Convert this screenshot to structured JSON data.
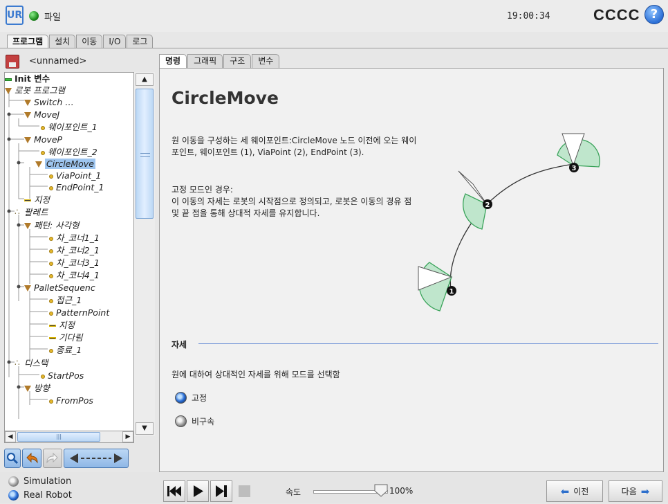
{
  "topbar": {
    "logo": "UR",
    "file_label": "파일",
    "clock": "19:00:34",
    "robot_name": "CCCC",
    "help": "?"
  },
  "main_tabs": [
    "프로그램",
    "설치",
    "이동",
    "I/O",
    "로그"
  ],
  "program": {
    "name": "<unnamed>",
    "tree": [
      {
        "label": "Init 변수",
        "icon": "green-bar",
        "bold": true,
        "italic": false
      },
      {
        "label": "로봇 프로그램",
        "icon": "triangle",
        "bold": false,
        "italic": true
      },
      {
        "label": "Switch …",
        "icon": "triangle",
        "bold": false,
        "italic": true
      },
      {
        "label": "MoveJ",
        "icon": "triangle",
        "bold": false,
        "italic": true
      },
      {
        "label": "웨이포인트_1",
        "icon": "dot",
        "bold": false,
        "italic": true
      },
      {
        "label": "MoveP",
        "icon": "triangle",
        "bold": false,
        "italic": true
      },
      {
        "label": "웨이포인트_2",
        "icon": "dot",
        "bold": false,
        "italic": true
      },
      {
        "label": "CircleMove",
        "icon": "triangle",
        "bold": false,
        "italic": true,
        "selected": true
      },
      {
        "label": "ViaPoint_1",
        "icon": "dot",
        "bold": false,
        "italic": true
      },
      {
        "label": "EndPoint_1",
        "icon": "dot",
        "bold": false,
        "italic": true
      },
      {
        "label": "지정",
        "icon": "bar",
        "bold": false,
        "italic": true
      },
      {
        "label": "팔레트",
        "icon": "pallet",
        "bold": false,
        "italic": true
      },
      {
        "label": "패턴: 사각형",
        "icon": "triangle",
        "bold": false,
        "italic": true
      },
      {
        "label": "차_코너1_1",
        "icon": "dot",
        "bold": false,
        "italic": true
      },
      {
        "label": "차_코너2_1",
        "icon": "dot",
        "bold": false,
        "italic": true
      },
      {
        "label": "차_코너3_1",
        "icon": "dot",
        "bold": false,
        "italic": true
      },
      {
        "label": "차_코너4_1",
        "icon": "dot",
        "bold": false,
        "italic": true
      },
      {
        "label": "PalletSequenc",
        "icon": "triangle",
        "bold": false,
        "italic": true
      },
      {
        "label": "접근_1",
        "icon": "dot",
        "bold": false,
        "italic": true
      },
      {
        "label": "PatternPoint",
        "icon": "dot",
        "bold": false,
        "italic": true
      },
      {
        "label": "지정",
        "icon": "bar",
        "bold": false,
        "italic": true
      },
      {
        "label": "기다림",
        "icon": "bar",
        "bold": false,
        "italic": true
      },
      {
        "label": "종료_1",
        "icon": "dot",
        "bold": false,
        "italic": true
      },
      {
        "label": "디스택",
        "icon": "pallet",
        "bold": false,
        "italic": true
      },
      {
        "label": "StartPos",
        "icon": "dot",
        "bold": false,
        "italic": true
      },
      {
        "label": "방향",
        "icon": "triangle",
        "bold": false,
        "italic": true
      },
      {
        "label": "FromPos",
        "icon": "dot",
        "bold": false,
        "italic": true
      }
    ]
  },
  "sub_tabs": [
    "명령",
    "그래픽",
    "구조",
    "변수"
  ],
  "command": {
    "title": "CircleMove",
    "desc1": "원 이동을 구성하는 세 웨이포인트:CircleMove 노드 이전에 오는 웨이포인트, 웨이포인트 (1), ViaPoint (2), EndPoint (3).",
    "desc2_head": "고정 모드인 경우:",
    "desc2": "이 이동의 자세는 로봇의 시작점으로 정의되고, 로봇은 이동의 경유 점 및 끝 점을 통해 상대적 자세를 유지합니다.",
    "diagram_labels": [
      "1",
      "2",
      "3"
    ],
    "section_label": "자세",
    "section_desc": "원에 대하여 상대적인 자세를 위해 모드를 선택함",
    "options": [
      {
        "label": "고정",
        "selected": true
      },
      {
        "label": "비구속",
        "selected": false
      }
    ]
  },
  "bottombar": {
    "modes": [
      {
        "label": "Simulation",
        "selected": false
      },
      {
        "label": "Real Robot",
        "selected": true
      }
    ],
    "speed_label": "속도",
    "speed_value": "100%",
    "speed_fraction": 1.0,
    "prev_label": "이전",
    "next_label": "다음"
  },
  "colors": {
    "accent": "#2c6fd6",
    "tree_selected": "#9ec5ef",
    "cone_fill": "#bfe6cc",
    "cone_stroke": "#3aa35a"
  }
}
